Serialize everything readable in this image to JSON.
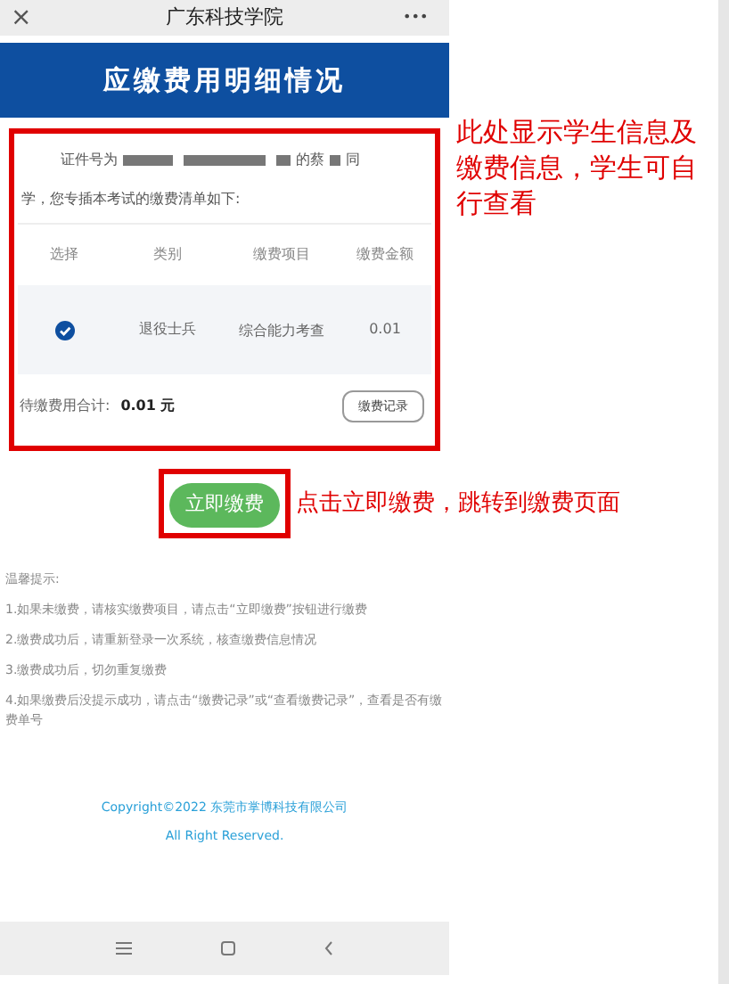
{
  "top_bar": {
    "close": "×",
    "title": "广东科技学院",
    "more": "•••"
  },
  "header": {
    "title": "应缴费用明细情况"
  },
  "intro": {
    "prefix": "证件号为",
    "middle": "的蔡",
    "suffix_line1": "同",
    "suffix_line2": "学，您专插本考试的缴费清单如下:"
  },
  "table": {
    "columns": [
      "选择",
      "类别",
      "缴费项目",
      "缴费金额"
    ],
    "rows": [
      {
        "selected": true,
        "category": "退役士兵",
        "item": "综合能力考查",
        "amount": "0.01"
      }
    ]
  },
  "total": {
    "label": "待缴费用合计:",
    "value": "0.01 元"
  },
  "record_button": "缴费记录",
  "pay_button": "立即缴费",
  "annotations": [
    "此处显示学生信息及缴费信息，学生可自行查看",
    "点击立即缴费，跳转到缴费页面"
  ],
  "tips": {
    "title": "温馨提示:",
    "items": [
      "1.如果未缴费，请核实缴费项目，请点击“立即缴费”按钮进行缴费",
      "2.缴费成功后，请重新登录一次系统，核查缴费信息情况",
      "3.缴费成功后，切勿重复缴费",
      "4.如果缴费后没提示成功，请点击“缴费记录”或“查看缴费记录”，查看是否有缴费单号"
    ]
  },
  "footer": {
    "copyright": "Copyright©2022 东莞市掌博科技有限公司",
    "rights": "All Right Reserved."
  }
}
